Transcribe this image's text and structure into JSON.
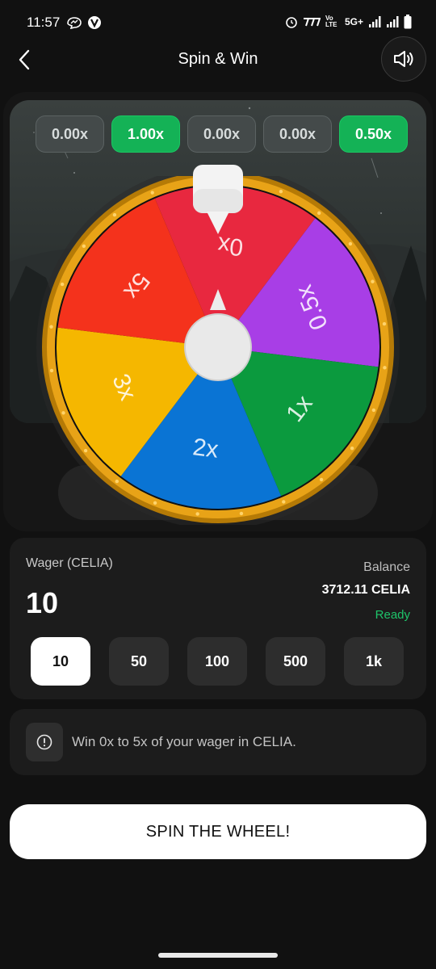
{
  "status_bar": {
    "time": "11:57",
    "network": "5G+",
    "volte": "Vo LTE",
    "left_icons": [
      "messenger-icon",
      "vpn-icon"
    ],
    "right_icons": [
      "alarm-icon",
      "carrier-icon",
      "signal-icon",
      "signal-icon",
      "battery-icon"
    ]
  },
  "header": {
    "title": "Spin & Win",
    "back_icon": "chevron-left-icon",
    "sound_icon": "speaker-icon"
  },
  "history": [
    {
      "label": "0.00x",
      "win": false
    },
    {
      "label": "1.00x",
      "win": true
    },
    {
      "label": "0.00x",
      "win": false
    },
    {
      "label": "0.00x",
      "win": false
    },
    {
      "label": "0.50x",
      "win": true
    }
  ],
  "wheel": {
    "segments": [
      {
        "label": "0x",
        "color": "#e8283f"
      },
      {
        "label": "0.5x",
        "color": "#a83ee6"
      },
      {
        "label": "1x",
        "color": "#0b9a3e"
      },
      {
        "label": "2x",
        "color": "#0a74d4"
      },
      {
        "label": "3x",
        "color": "#f5b700"
      },
      {
        "label": "5x",
        "color": "#f4321c"
      }
    ],
    "rim_color": "#e8a317"
  },
  "wager": {
    "label": "Wager (CELIA)",
    "value": "10",
    "balance_label": "Balance",
    "balance_value": "3712.11 CELIA",
    "status": "Ready",
    "amounts": [
      {
        "label": "10",
        "selected": true
      },
      {
        "label": "50",
        "selected": false
      },
      {
        "label": "100",
        "selected": false
      },
      {
        "label": "500",
        "selected": false
      },
      {
        "label": "1k",
        "selected": false
      }
    ]
  },
  "info": {
    "icon": "info-icon",
    "text": "Win 0x to 5x of your wager in CELIA."
  },
  "spin_button": {
    "label": "SPIN THE WHEEL!"
  },
  "colors": {
    "accent_green": "#14b256",
    "ready_green": "#1ec46a",
    "background": "#111111",
    "card": "#1c1c1c"
  }
}
